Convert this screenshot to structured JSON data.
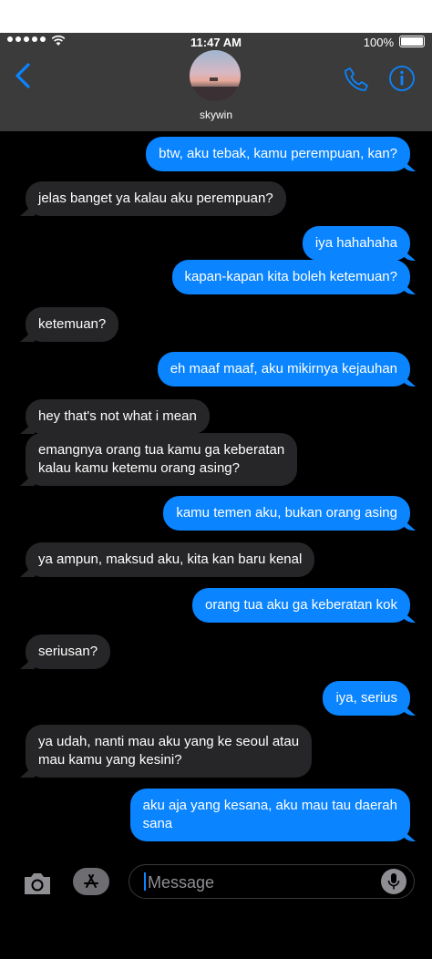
{
  "status_bar": {
    "time": "11:47 AM",
    "battery": "100%"
  },
  "header": {
    "contact_name": "skywin"
  },
  "colors": {
    "outgoing": "#0a84ff",
    "incoming": "#262628",
    "accent": "#0a84ff"
  },
  "messages": [
    {
      "dir": "out",
      "lines": [
        "btw, aku tebak, kamu perempuan, kan?"
      ]
    },
    {
      "dir": "in",
      "lines": [
        "jelas banget ya kalau aku perempuan?"
      ]
    },
    {
      "dir": "out",
      "lines": [
        "iya hahahaha"
      ]
    },
    {
      "dir": "out",
      "lines": [
        "kapan-kapan kita boleh ketemuan?"
      ]
    },
    {
      "dir": "in",
      "lines": [
        "ketemuan?"
      ]
    },
    {
      "dir": "out",
      "lines": [
        "eh maaf maaf, aku mikirnya kejauhan"
      ]
    },
    {
      "dir": "in",
      "lines": [
        "hey that's not what i mean"
      ]
    },
    {
      "dir": "in",
      "lines": [
        "emangnya orang tua kamu ga keberatan",
        "kalau kamu ketemu orang asing?"
      ]
    },
    {
      "dir": "out",
      "lines": [
        "kamu temen aku, bukan orang asing"
      ]
    },
    {
      "dir": "in",
      "lines": [
        "ya ampun, maksud aku, kita kan baru kenal"
      ]
    },
    {
      "dir": "out",
      "lines": [
        "orang tua aku ga keberatan kok"
      ]
    },
    {
      "dir": "in",
      "lines": [
        "seriusan?"
      ]
    },
    {
      "dir": "out",
      "lines": [
        "iya, serius"
      ]
    },
    {
      "dir": "in",
      "lines": [
        "ya udah, nanti mau aku yang ke seoul atau",
        "mau kamu yang kesini?"
      ]
    },
    {
      "dir": "out",
      "lines": [
        "aku aja yang kesana, aku mau tau daerah",
        "sana"
      ]
    }
  ],
  "composer": {
    "placeholder": "Message"
  }
}
